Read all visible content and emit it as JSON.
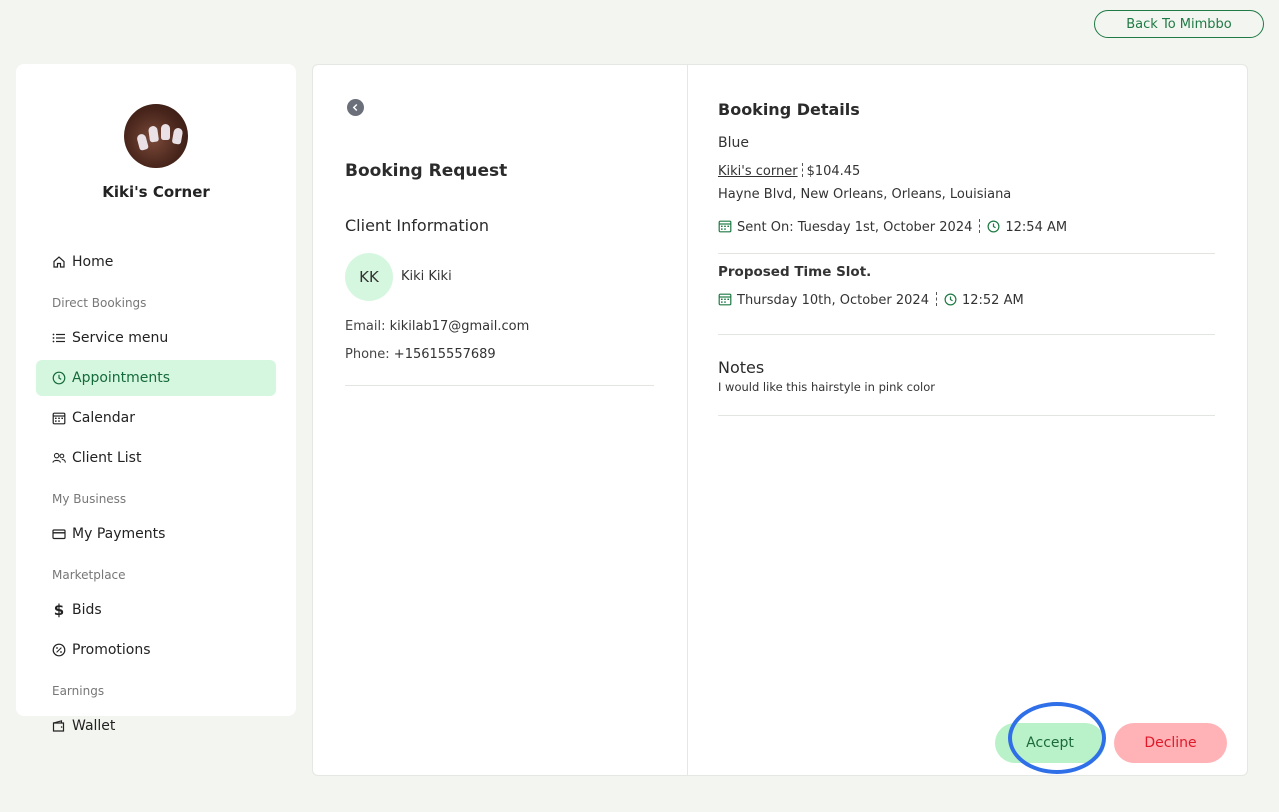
{
  "header": {
    "back_label": "Back To Mimbbo"
  },
  "sidebar": {
    "business_name": "Kiki's Corner",
    "items": [
      {
        "label": "Home",
        "icon": "home-icon"
      },
      {
        "section": "Direct Bookings"
      },
      {
        "label": "Service menu",
        "icon": "list-icon"
      },
      {
        "label": "Appointments",
        "icon": "clock-icon",
        "active": true
      },
      {
        "label": "Calendar",
        "icon": "calendar-icon"
      },
      {
        "label": "Client List",
        "icon": "users-icon"
      },
      {
        "section": "My Business"
      },
      {
        "label": "My Payments",
        "icon": "card-icon"
      },
      {
        "section": "Marketplace"
      },
      {
        "label": "Bids",
        "icon": "dollar-icon"
      },
      {
        "label": "Promotions",
        "icon": "discount-icon"
      },
      {
        "section": "Earnings"
      },
      {
        "label": "Wallet",
        "icon": "wallet-icon"
      }
    ]
  },
  "request": {
    "title": "Booking Request",
    "client_heading": "Client Information",
    "initials": "KK",
    "client_name": "Kiki Kiki",
    "email_label": "Email:",
    "email": "kikilab17@gmail.com",
    "phone_label": "Phone:",
    "phone": "+15615557689"
  },
  "details": {
    "heading": "Booking Details",
    "service": "Blue",
    "vendor": "Kiki's corner",
    "price": "$104.45",
    "address": "Hayne Blvd, New Orleans, Orleans, Louisiana",
    "sent_on": "Sent On: Tuesday 1st, October 2024",
    "sent_time": "12:54 AM",
    "proposed_heading": "Proposed Time Slot.",
    "proposed_date": "Thursday 10th, October 2024",
    "proposed_time": "12:52 AM",
    "notes_heading": "Notes",
    "notes": "I would like this hairstyle in pink color"
  },
  "actions": {
    "accept_label": "Accept",
    "decline_label": "Decline"
  },
  "colors": {
    "accent": "#1f7a45",
    "active_bg": "#d6f7df",
    "accept_bg": "#b9f2c8",
    "decline_bg": "#ffb3b6",
    "decline_text": "#e0182a",
    "highlight": "#2f6fe8"
  }
}
